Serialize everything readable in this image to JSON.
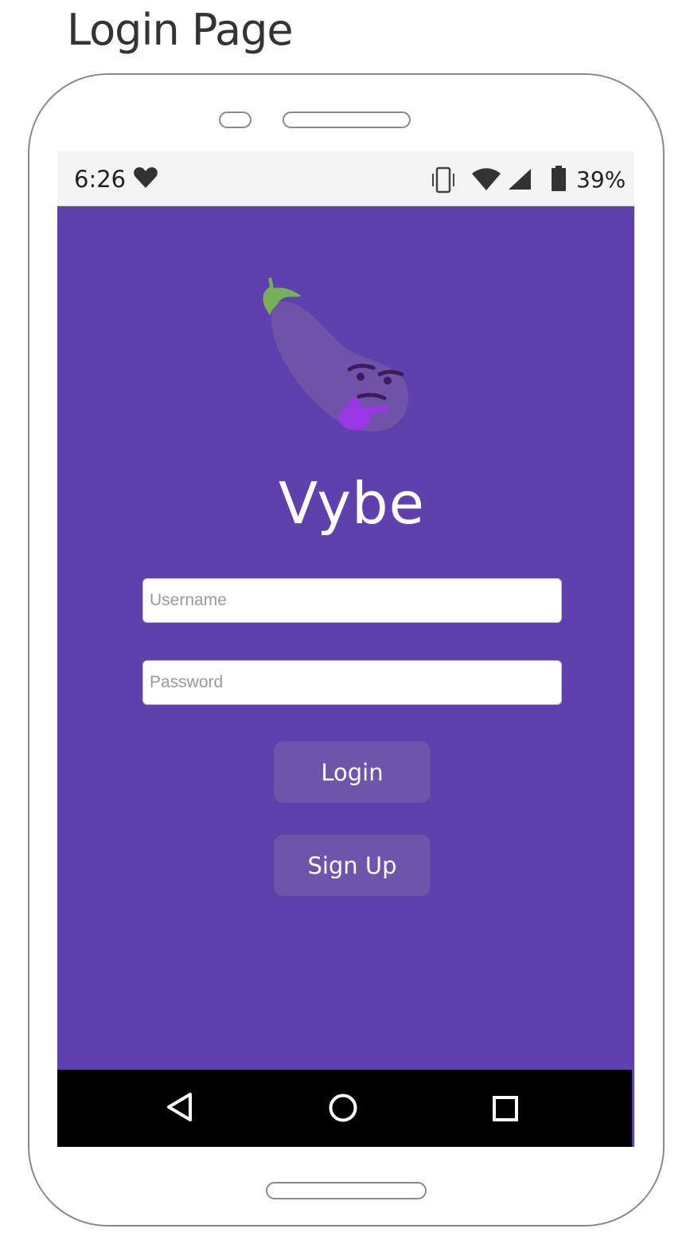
{
  "page_heading": "Login Page",
  "status_bar": {
    "time": "6:26",
    "battery_percent": "39%",
    "icons": [
      "heart-icon",
      "vibrate-icon",
      "wifi-icon",
      "signal-icon",
      "battery-icon"
    ]
  },
  "app": {
    "title": "Vybe",
    "logo": "eggplant-thinking-logo"
  },
  "form": {
    "username_placeholder": "Username",
    "password_placeholder": "Password",
    "login_label": "Login",
    "signup_label": "Sign Up"
  },
  "nav_bar": {
    "icons": [
      "back-icon",
      "home-icon",
      "recents-icon"
    ]
  },
  "colors": {
    "screen_background": "#5f41ad",
    "button_background": "#6e54ab",
    "status_bar": "#f4f4f4",
    "nav_bar": "#000000"
  }
}
